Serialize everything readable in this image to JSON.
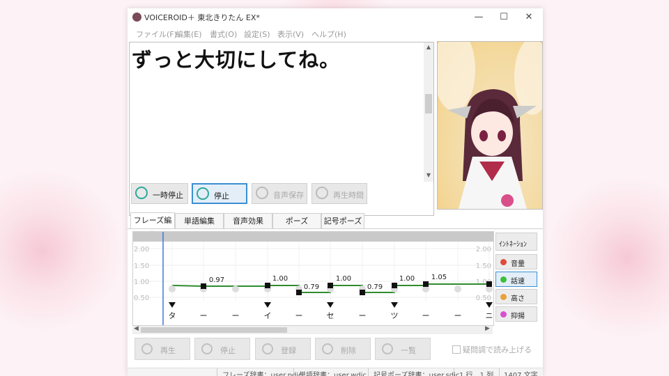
{
  "window": {
    "title": "VOICEROID＋ 東北きりたん EX*"
  },
  "controls": {
    "minimize": "—",
    "maximize": "☐",
    "close": "✕"
  },
  "menu": [
    "ファイル(F)",
    "編集(E)",
    "書式(O)",
    "設定(S)",
    "表示(V)",
    "ヘルプ(H)"
  ],
  "editor_text": "ずっと大切にしてね。",
  "play_buttons": [
    {
      "label": "一時停止",
      "icon": "pause-icon",
      "state": "normal"
    },
    {
      "label": "停止",
      "icon": "stop-icon",
      "state": "active"
    },
    {
      "label": "音声保存",
      "icon": "save-icon",
      "state": "disabled"
    },
    {
      "label": "再生時間",
      "icon": "clock-icon",
      "state": "disabled"
    }
  ],
  "tabs": [
    "フレーズ編集",
    "単語編集",
    "音声効果",
    "ポーズ",
    "記号ポーズ"
  ],
  "active_tab": "フレーズ編集",
  "graph": {
    "y_ticks": [
      "2.00",
      "1.50",
      "1.00",
      "0.50"
    ],
    "line_color": "#2e8b2e",
    "value_labels": [
      "0.97",
      "1.00",
      "0.79",
      "1.00",
      "0.79",
      "1.00",
      "1.05"
    ],
    "kana": [
      "タ",
      "ー",
      "ー",
      "イ",
      "ー",
      "セ",
      "ー",
      "ツ",
      "ー",
      "ー",
      "ニ"
    ]
  },
  "side_buttons": [
    {
      "label": "ｲﾝﾄﾈｰｼｮﾝ",
      "color": "",
      "active": false
    },
    {
      "label": "音量",
      "color": "#e04b3a",
      "active": false
    },
    {
      "label": "話速",
      "color": "#3cbf3c",
      "active": true
    },
    {
      "label": "高さ",
      "color": "#e8a23a",
      "active": false
    },
    {
      "label": "抑揚",
      "color": "#d94fd0",
      "active": false
    }
  ],
  "bottom_buttons": [
    {
      "label": "再生",
      "icon": "play-icon"
    },
    {
      "label": "停止",
      "icon": "stop-icon"
    },
    {
      "label": "登録",
      "icon": "book-icon"
    },
    {
      "label": "削除",
      "icon": "trash-icon"
    },
    {
      "label": "一覧",
      "icon": "list-icon"
    }
  ],
  "checkbox_label": "疑問調で読み上げる",
  "status": {
    "phrase_dict": "フレーズ辞書：user.pdic",
    "word_dict": "単語辞書：user.wdic",
    "symbol_dict": "記号ポーズ辞書：user.sdic",
    "position": "1 行、1 列",
    "chars": "1407 文字"
  }
}
